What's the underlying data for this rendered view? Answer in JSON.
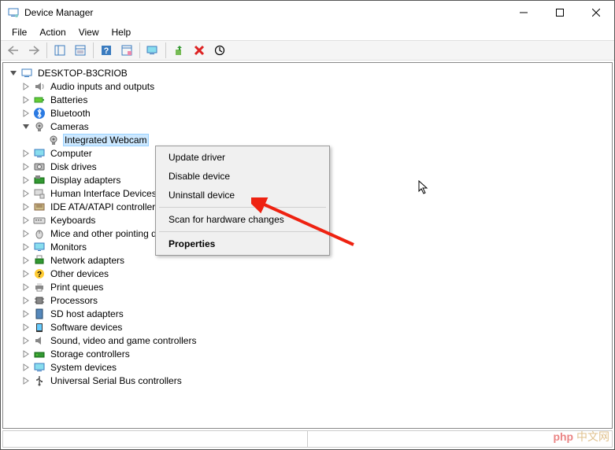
{
  "window": {
    "title": "Device Manager"
  },
  "menubar": {
    "file": "File",
    "action": "Action",
    "view": "View",
    "help": "Help"
  },
  "tree": {
    "root": "DESKTOP-B3CRIOB",
    "nodes": {
      "audio": "Audio inputs and outputs",
      "batteries": "Batteries",
      "bluetooth": "Bluetooth",
      "cameras": "Cameras",
      "webcam": "Integrated Webcam",
      "computer": "Computer",
      "disk": "Disk drives",
      "display": "Display adapters",
      "hid": "Human Interface Devices",
      "ide": "IDE ATA/ATAPI controllers",
      "keyboards": "Keyboards",
      "mice": "Mice and other pointing devices",
      "monitors": "Monitors",
      "network": "Network adapters",
      "other": "Other devices",
      "print": "Print queues",
      "processors": "Processors",
      "sdhost": "SD host adapters",
      "software": "Software devices",
      "sound": "Sound, video and game controllers",
      "storage": "Storage controllers",
      "system": "System devices",
      "usb": "Universal Serial Bus controllers"
    }
  },
  "context_menu": {
    "update": "Update driver",
    "disable": "Disable device",
    "uninstall": "Uninstall device",
    "scan": "Scan for hardware changes",
    "properties": "Properties"
  },
  "watermark": "php中文网"
}
